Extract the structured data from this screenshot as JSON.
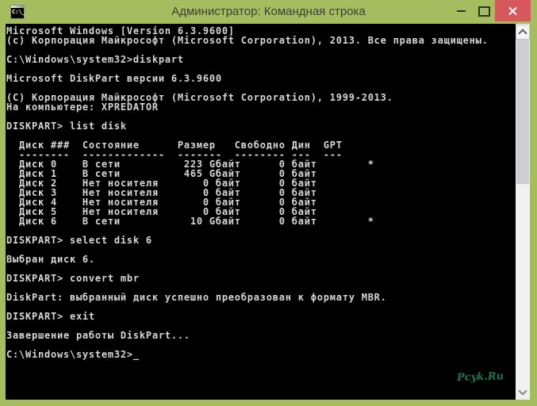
{
  "window": {
    "title": "Администратор: Командная строка",
    "app_icon_text": "C:\\_",
    "controls": [
      "minimize-button",
      "maximize-button",
      "close-button"
    ]
  },
  "colors": {
    "titlebar_green": "#a6bd5f",
    "title_text": "#3b3e35",
    "close_button_red": "#d6585c",
    "console_background": "#000000",
    "console_text": "#d6d6d6",
    "scrollbar_track": "#f0f0f0",
    "scrollbar_thumb": "#cdced2",
    "watermark_teal": "#1e6b52"
  },
  "console": {
    "lines": [
      "Microsoft Windows [Version 6.3.9600]",
      "(c) Корпорация Майкрософт (Microsoft Corporation), 2013. Все права защищены.",
      "",
      "C:\\Windows\\system32>diskpart",
      "",
      "Microsoft DiskPart версии 6.3.9600",
      "",
      "(C) Корпорация Майкрософт (Microsoft Corporation), 1999-2013.",
      "На компьютере: XPREDATOR",
      "",
      "DISKPART> list disk",
      "",
      "  Диск ###  Состояние      Размер   Свободно Дин  GPT",
      "  --------  -------------  -------  -------- ---  ---",
      "  Диск 0    В сети          223 Gбайт      0 байт        *",
      "  Диск 1    В сети          465 Gбайт      0 байт",
      "  Диск 2    Нет носителя       0 байт      0 байт",
      "  Диск 3    Нет носителя       0 байт      0 байт",
      "  Диск 4    Нет носителя       0 байт      0 байт",
      "  Диск 5    Нет носителя       0 байт      0 байт",
      "  Диск 6    В сети           10 Gбайт      0 байт        *",
      "",
      "DISKPART> select disk 6",
      "",
      "Выбран диск 6.",
      "",
      "DISKPART> convert mbr",
      "",
      "DiskPart: выбранный диск успешно преобразован к формату MBR.",
      "",
      "DISKPART> exit",
      "",
      "Завершение работы DiskPart...",
      ""
    ],
    "prompt": "C:\\Windows\\system32>",
    "cursor": "_"
  },
  "disk_table": {
    "columns": [
      "Диск ###",
      "Состояние",
      "Размер",
      "Свободно",
      "Дин",
      "GPT"
    ],
    "rows": [
      {
        "disk": "Диск 0",
        "status": "В сети",
        "size": "223 Gбайт",
        "free": "0 байт",
        "dyn": "",
        "gpt": "*"
      },
      {
        "disk": "Диск 1",
        "status": "В сети",
        "size": "465 Gбайт",
        "free": "0 байт",
        "dyn": "",
        "gpt": ""
      },
      {
        "disk": "Диск 2",
        "status": "Нет носителя",
        "size": "0 байт",
        "free": "0 байт",
        "dyn": "",
        "gpt": ""
      },
      {
        "disk": "Диск 3",
        "status": "Нет носителя",
        "size": "0 байт",
        "free": "0 байт",
        "dyn": "",
        "gpt": ""
      },
      {
        "disk": "Диск 4",
        "status": "Нет носителя",
        "size": "0 байт",
        "free": "0 байт",
        "dyn": "",
        "gpt": ""
      },
      {
        "disk": "Диск 5",
        "status": "Нет носителя",
        "size": "0 байт",
        "free": "0 байт",
        "dyn": "",
        "gpt": ""
      },
      {
        "disk": "Диск 6",
        "status": "В сети",
        "size": "10 Gбайт",
        "free": "0 байт",
        "dyn": "",
        "gpt": "*"
      }
    ]
  },
  "watermark": "Pcyk.Ru",
  "scrollbar": {
    "orientation": "vertical",
    "thumb_position": "upper"
  }
}
